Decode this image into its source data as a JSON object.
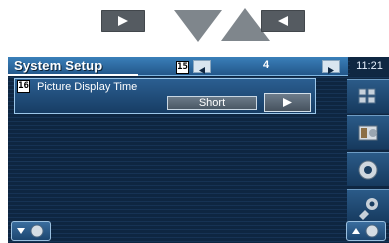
{
  "header": {
    "title": "System Setup",
    "page_number": "4",
    "callout_page": "15",
    "clock": "11:21"
  },
  "setting": {
    "callout": "16",
    "label": "Picture Display Time",
    "value": "Short"
  },
  "icons": {
    "nav_prev": "play-reverse-icon",
    "nav_next": "play-icon",
    "side": [
      "grid-menu-icon",
      "media-icon",
      "audio-icon",
      "setup-wrench-icon"
    ],
    "bottom_left": "scroll-down-icon",
    "bottom_right": "scroll-up-icon"
  },
  "colors": {
    "header_blue": "#2f6ca4",
    "screen_background": "#0f2742",
    "nav_triangle": "#7f868c"
  }
}
